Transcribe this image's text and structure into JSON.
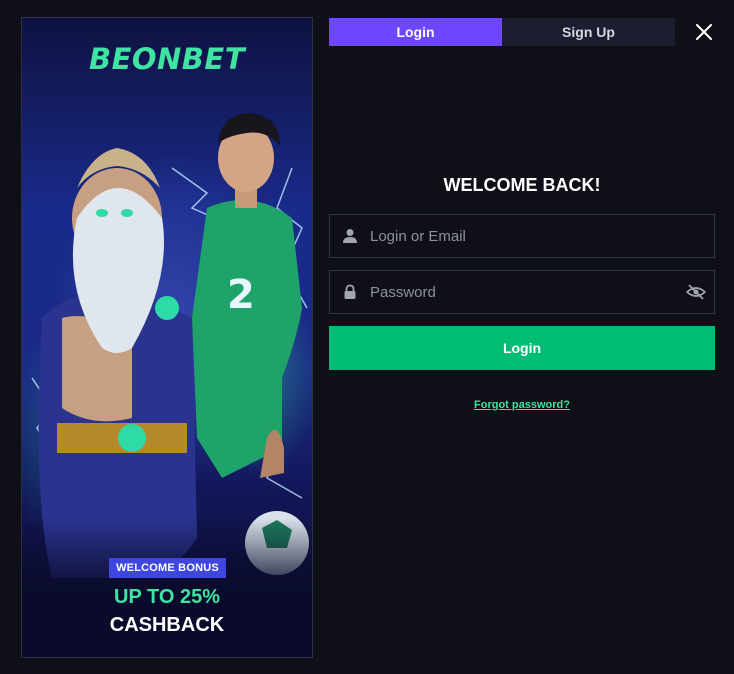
{
  "banner": {
    "logo_text": "BEONBET",
    "bonus_badge": "WELCOME BONUS",
    "bonus_line1": "UP TO 25%",
    "bonus_line2": "CASHBACK",
    "illustration": "zeus-and-soccer-player-artwork"
  },
  "tabs": [
    {
      "label": "Login",
      "active": true
    },
    {
      "label": "Sign Up",
      "active": false
    }
  ],
  "close_icon": "close-icon",
  "form": {
    "title": "WELCOME BACK!",
    "login_placeholder": "Login or Email",
    "login_value": "",
    "password_placeholder": "Password",
    "password_value": "",
    "submit_label": "Login",
    "forgot_label": "Forgot password?"
  },
  "colors": {
    "accent_purple": "#6c47ff",
    "accent_green": "#00bd76",
    "brand_green": "#3fe3a2",
    "badge_blue": "#3f46e0",
    "background": "#0f0f17"
  }
}
